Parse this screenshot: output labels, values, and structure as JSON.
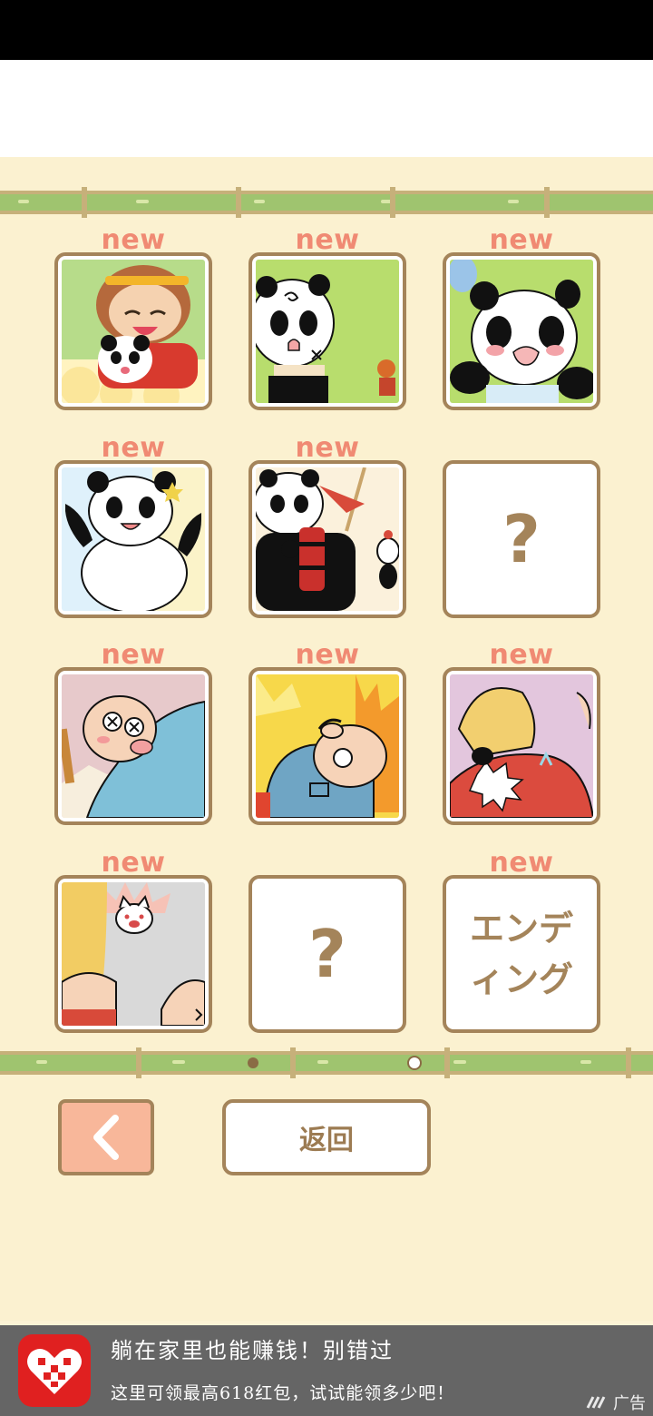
{
  "gallery": {
    "cells": [
      {
        "new_label": "new",
        "kind": "image",
        "image": "monkey-king-holding-panda"
      },
      {
        "new_label": "new",
        "kind": "image",
        "image": "bandaged-panda-green"
      },
      {
        "new_label": "new",
        "kind": "image",
        "image": "crying-panda-green"
      },
      {
        "new_label": "new",
        "kind": "image",
        "image": "happy-panda-sky"
      },
      {
        "new_label": "new",
        "kind": "image",
        "image": "panda-with-dynamite"
      },
      {
        "new_label": "",
        "kind": "locked",
        "text": "?"
      },
      {
        "new_label": "new",
        "kind": "image",
        "image": "dazed-old-man"
      },
      {
        "new_label": "new",
        "kind": "image",
        "image": "old-man-on-fire"
      },
      {
        "new_label": "new",
        "kind": "image",
        "image": "blonde-boy-punched"
      },
      {
        "new_label": "new",
        "kind": "image",
        "image": "angry-cat-closeup"
      },
      {
        "new_label": "",
        "kind": "locked",
        "text": "?"
      },
      {
        "new_label": "new",
        "kind": "ending",
        "text_line1": "エンデ",
        "text_line2": "ィング"
      }
    ],
    "page_indicator": {
      "pages": 2,
      "current": 2
    }
  },
  "nav": {
    "back_icon": "chevron-left-icon",
    "return_label": "返回"
  },
  "ad": {
    "title": "躺在家里也能赚钱！别错过",
    "subtitle": "这里可领最高618红包，试试能领多少吧！",
    "label": "广告",
    "logo_icon": "shopping-app-logo-icon"
  },
  "colors": {
    "accent": "#a4845a",
    "new_label": "#f08a73",
    "background": "#fbf1d0",
    "bamboo": "#9fc46f"
  }
}
